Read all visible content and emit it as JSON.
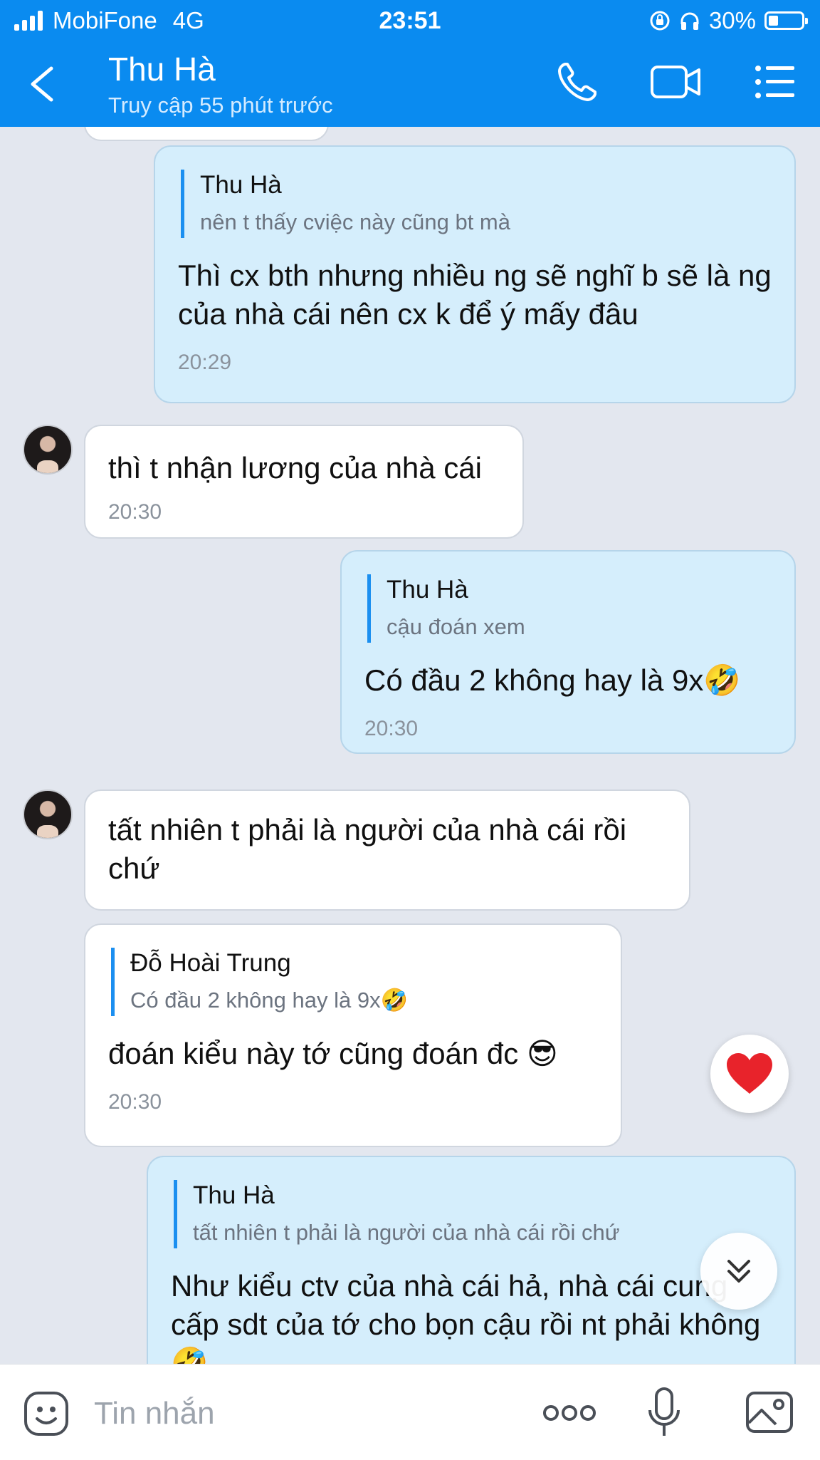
{
  "statusbar": {
    "carrier": "MobiFone",
    "network": "4G",
    "time": "23:51",
    "battery_text": "30%",
    "battery_level": 0.3
  },
  "header": {
    "contact_name": "Thu Hà",
    "contact_status": "Truy cập 55 phút trước",
    "icons": [
      "back-arrow-icon",
      "phone-icon",
      "video-call-icon",
      "menu-list-icon"
    ]
  },
  "messages": [
    {
      "direction": "sent",
      "quote": {
        "name": "Thu Hà",
        "text": "nên t thấy cviệc này cũng bt mà"
      },
      "text": "Thì cx bth nhưng nhiều ng sẽ nghĩ b sẽ là ng của nhà cái nên cx k để ý mấy đâu",
      "time": "20:29"
    },
    {
      "direction": "received",
      "text": "thì t nhận lương của nhà cái",
      "time": "20:30"
    },
    {
      "direction": "sent",
      "quote": {
        "name": "Thu Hà",
        "text": "cậu đoán xem"
      },
      "text": "Có đầu 2 không hay là 9x🤣",
      "time": "20:30"
    },
    {
      "direction": "received",
      "text": "tất nhiên t phải là người của nhà cái rồi chứ"
    },
    {
      "direction": "received",
      "quote": {
        "name": "Đỗ Hoài Trung",
        "text": "Có đầu 2 không hay là 9x🤣"
      },
      "text": "đoán kiểu này tớ cũng đoán đc 😎",
      "time": "20:30"
    },
    {
      "direction": "sent",
      "quote": {
        "name": "Thu Hà",
        "text": "tất nhiên t phải là người của nhà cái rồi chứ"
      },
      "text": "Như kiểu ctv của nhà cái hả, nhà cái cung cấp sdt của tớ cho bọn cậu rồi nt phải không🤣"
    }
  ],
  "reaction": {
    "icon": "heart-icon",
    "color": "#e8232b"
  },
  "input": {
    "placeholder": "Tin nhắn",
    "icons": [
      "sticker-icon",
      "more-options-icon",
      "microphone-icon",
      "image-icon"
    ]
  },
  "colors": {
    "header_bg": "#0a8bf0",
    "chat_bg": "#e3e7ef",
    "sent_bubble": "#d5eefc",
    "received_bubble": "#ffffff",
    "quote_bar": "#1b8ff0"
  }
}
